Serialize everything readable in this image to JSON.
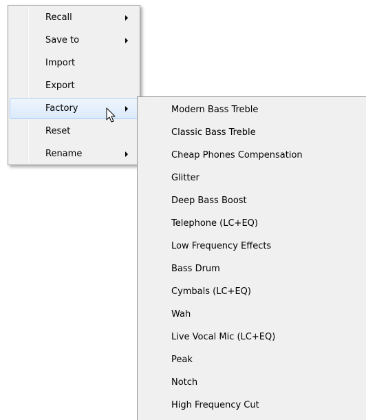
{
  "main_menu": {
    "items": [
      {
        "label": "Recall",
        "has_submenu": true,
        "highlighted": false
      },
      {
        "label": "Save to",
        "has_submenu": true,
        "highlighted": false
      },
      {
        "label": "Import",
        "has_submenu": false,
        "highlighted": false
      },
      {
        "label": "Export",
        "has_submenu": false,
        "highlighted": false
      },
      {
        "label": "Factory",
        "has_submenu": true,
        "highlighted": true
      },
      {
        "label": "Reset",
        "has_submenu": false,
        "highlighted": false
      },
      {
        "label": "Rename",
        "has_submenu": true,
        "highlighted": false
      }
    ]
  },
  "factory_submenu": {
    "items": [
      {
        "label": "Modern Bass Treble"
      },
      {
        "label": "Classic Bass Treble"
      },
      {
        "label": "Cheap Phones Compensation"
      },
      {
        "label": "Glitter"
      },
      {
        "label": "Deep Bass Boost"
      },
      {
        "label": "Telephone (LC+EQ)"
      },
      {
        "label": "Low Frequency Effects"
      },
      {
        "label": "Bass Drum"
      },
      {
        "label": "Cymbals (LC+EQ)"
      },
      {
        "label": "Wah"
      },
      {
        "label": "Live Vocal Mic (LC+EQ)"
      },
      {
        "label": "Peak"
      },
      {
        "label": "Notch"
      },
      {
        "label": "High Frequency Cut"
      }
    ]
  },
  "colors": {
    "menu_background": "#f0f0f0",
    "menu_border": "#979797",
    "highlight_border": "#a8d1f9",
    "highlight_fill": "#dbeafb"
  },
  "icons": {
    "cursor": "mouse-pointer-icon",
    "submenu_arrow": "submenu-arrow-icon"
  }
}
